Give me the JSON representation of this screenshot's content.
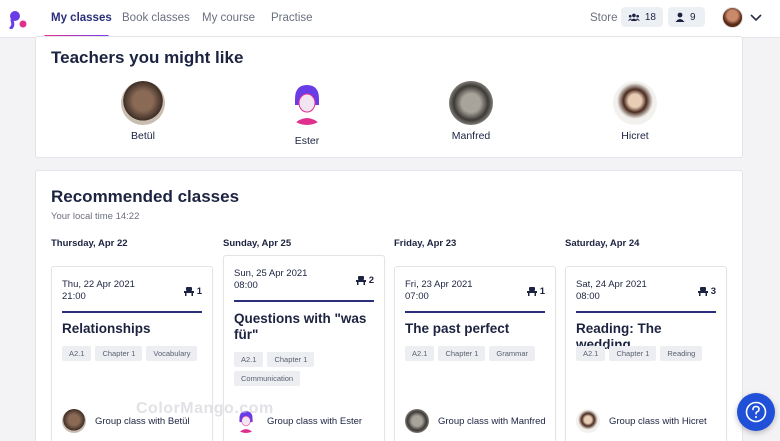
{
  "nav": {
    "tabs": [
      {
        "label": "My classes",
        "active": true
      },
      {
        "label": "Book classes",
        "active": false
      },
      {
        "label": "My course",
        "active": false
      },
      {
        "label": "Practise",
        "active": false
      }
    ],
    "store_label": "Store",
    "group_count": "18",
    "private_count": "9",
    "icons": [
      "logo-icon",
      "group-icon",
      "person-icon",
      "avatar",
      "chevron-down-icon"
    ]
  },
  "teachers_section": {
    "title": "Teachers you might like",
    "teachers": [
      {
        "name": "Betül"
      },
      {
        "name": "Ester"
      },
      {
        "name": "Manfred"
      },
      {
        "name": "Hicret"
      }
    ]
  },
  "recommended": {
    "title": "Recommended classes",
    "local_time": "Your local time 14:22",
    "columns": [
      {
        "day_heading": "Thursday, Apr 22",
        "date": "Thu, 22 Apr 2021",
        "time": "21:00",
        "seats": "1",
        "title": "Relationships",
        "tags": [
          "A2.1",
          "Chapter 1",
          "Vocabulary"
        ],
        "teacher_line": "Group class with Betül"
      },
      {
        "day_heading": "Sunday, Apr 25",
        "date": "Sun, 25 Apr 2021",
        "time": "08:00",
        "seats": "2",
        "title": "Questions with \"was für\"",
        "tags": [
          "A2.1",
          "Chapter 1",
          "Communication"
        ],
        "teacher_line": "Group class with Ester"
      },
      {
        "day_heading": "Friday, Apr 23",
        "date": "Fri, 23 Apr 2021",
        "time": "07:00",
        "seats": "1",
        "title": "The past perfect",
        "tags": [
          "A2.1",
          "Chapter 1",
          "Grammar"
        ],
        "teacher_line": "Group class with Manfred"
      },
      {
        "day_heading": "Saturday, Apr 24",
        "date": "Sat, 24 Apr 2021",
        "time": "08:00",
        "seats": "3",
        "title": "Reading: The wedding",
        "tags": [
          "A2.1",
          "Chapter 1",
          "Reading"
        ],
        "teacher_line": "Group class with Hicret"
      }
    ]
  },
  "watermark": "ColorMango.com",
  "colors": {
    "accent": "#2b2f7a",
    "brand_pink": "#e0308e",
    "brand_purple": "#7a3cf0",
    "help_button": "#2150d8"
  }
}
